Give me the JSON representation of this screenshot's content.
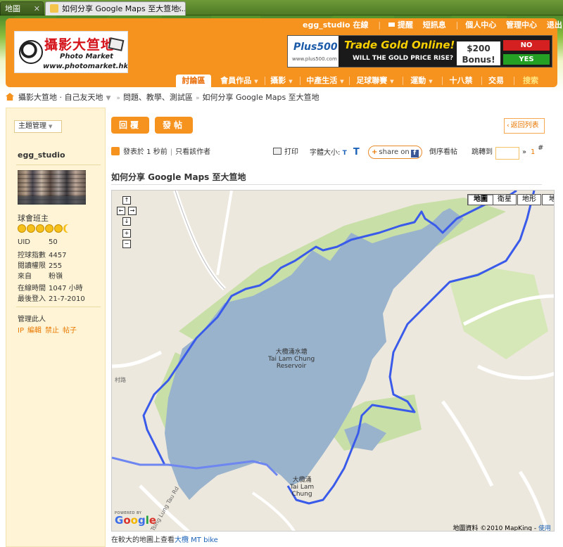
{
  "browser": {
    "tabs": [
      {
        "label": "地圖"
      },
      {
        "label": "如何分享 Google Maps 至大笪地..."
      }
    ]
  },
  "header": {
    "logo": {
      "cn": "攝影大笪地",
      "en": "Photo Market",
      "url": "www.photomarket.hk"
    },
    "userbar": {
      "username": "egg_studio",
      "status": "在線",
      "reminder": "提醒",
      "messages": "短訊息",
      "profile": "個人中心",
      "admin": "管理中心",
      "logout": "退出"
    },
    "ad": {
      "brand": "Plus500",
      "brand_url": "www.plus500.com",
      "headline": "Trade Gold Online!",
      "subline": "WILL THE GOLD PRICE RISE?",
      "bonus_amount": "$200",
      "bonus_label": "Bonus!",
      "no": "NO",
      "yes": "YES"
    },
    "nav": [
      {
        "label": "討論區",
        "active": true
      },
      {
        "label": "會員作品"
      },
      {
        "label": "攝影"
      },
      {
        "label": "中產生活"
      },
      {
        "label": "足球聯賽"
      },
      {
        "label": "運動"
      },
      {
        "label": "十八禁"
      },
      {
        "label": "交易"
      },
      {
        "label": "搜索"
      }
    ]
  },
  "breadcrumb": {
    "site": "攝影大笪地 · 自己友天地",
    "forum": "問題、教學、測試區",
    "current": "如何分享 Google Maps 至大笪地"
  },
  "sidebar": {
    "topic_manage": "主題管理",
    "username": "egg_studio",
    "rank": "球會班主",
    "stats": [
      {
        "k": "UID",
        "v": "50"
      },
      {
        "k": "控球指數",
        "v": "4457"
      },
      {
        "k": "閱讀權限",
        "v": "255"
      },
      {
        "k": "來自",
        "v": "粉嶺"
      },
      {
        "k": "在線時間",
        "v": "1047 小時"
      },
      {
        "k": "最後登入",
        "v": "21-7-2010"
      }
    ],
    "manage_label": "管理此人",
    "manage_links": [
      "IP",
      "編輯",
      "禁止",
      "帖子"
    ]
  },
  "post": {
    "reply_btn": "回覆",
    "new_btn": "發帖",
    "back_list": "返回列表",
    "posted": "發表於 1 秒前",
    "author_only": "只看該作者",
    "print": "打印",
    "font_size": "字體大小:",
    "font_small": "T",
    "font_big": "T",
    "share": "share on",
    "reverse": "倒序看帖",
    "goto": "跳轉到",
    "page": "1",
    "floor_mark": "#",
    "title": "如何分享 Google Maps 至大笪地"
  },
  "map": {
    "types": [
      "地圖",
      "衛星",
      "地形",
      "地"
    ],
    "reservoir_cn": "大欖涌水塘",
    "reservoir_en1": "Tai Lam Chung",
    "reservoir_en2": "Reservoir",
    "village_cn": "大欖涌",
    "village_en1": "Tai Lam",
    "village_en2": "Chung",
    "road_label": "村路",
    "road_label2": "Tsing Lung Tau Rd",
    "powered_by": "POWERED BY",
    "google": "Google",
    "credit": "地圖資料 ©2010 MapKing -",
    "terms": "使用",
    "route_color": "#3a5bea",
    "water_color": "#99b3cc",
    "green_color": "#c9dfa8"
  },
  "view_larger": {
    "prefix": "在較大的地圖上查看",
    "link": "大欖 MT bike"
  }
}
